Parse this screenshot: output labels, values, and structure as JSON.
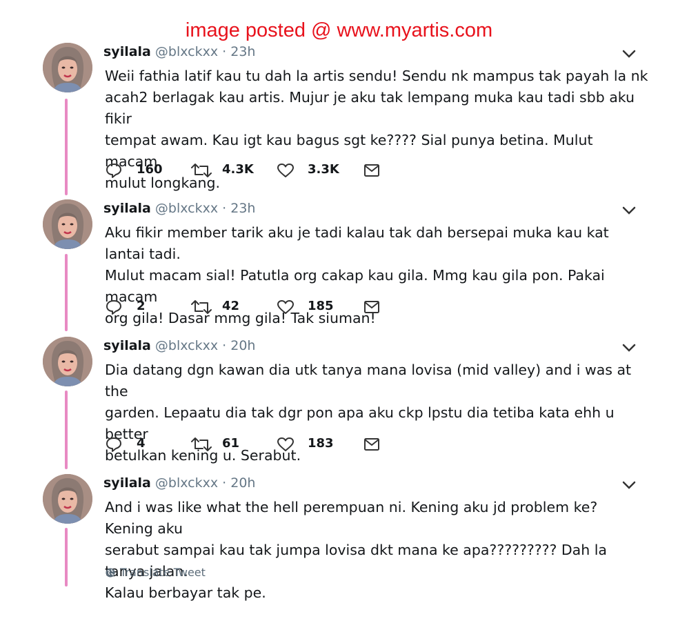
{
  "watermark": "image posted @ www.myartis.com",
  "colors": {
    "thread_line": "#e88ac3",
    "watermark": "#e8121c",
    "secondary_text": "#657786"
  },
  "tweets": [
    {
      "name": "syilala",
      "handle": "@blxckxx",
      "dot": "·",
      "time": "23h",
      "lines": [
        "Weii fathia latif kau tu dah la artis sendu! Sendu nk mampus tak payah la nk",
        "acah2 berlagak kau artis. Mujur je aku tak lempang muka kau tadi sbb aku fikir",
        "tempat awam. Kau igt kau bagus sgt ke???? Sial punya betina. Mulut macam",
        "mulut longkang."
      ],
      "replies": "160",
      "retweets": "4.3K",
      "likes": "3.3K"
    },
    {
      "name": "syilala",
      "handle": "@blxckxx",
      "dot": "·",
      "time": "23h",
      "lines": [
        "Aku fikir member tarik aku je tadi kalau tak dah bersepai muka kau kat lantai tadi.",
        "Mulut macam sial! Patutla org cakap kau gila. Mmg kau gila pon. Pakai macam",
        "org gila! Dasar mmg gila! Tak siuman!"
      ],
      "replies": "2",
      "retweets": "42",
      "likes": "185"
    },
    {
      "name": "syilala",
      "handle": "@blxckxx",
      "dot": "·",
      "time": "20h",
      "lines": [
        "Dia datang dgn kawan dia utk tanya mana lovisa (mid valley) and i was at the",
        "garden. Lepaatu dia tak dgr pon apa aku ckp lpstu dia tetiba kata ehh u better",
        "betulkan kening u. Serabut."
      ],
      "replies": "4",
      "retweets": "61",
      "likes": "183"
    },
    {
      "name": "syilala",
      "handle": "@blxckxx",
      "dot": "·",
      "time": "20h",
      "lines": [
        "And i was like what the hell perempuan ni. Kening aku jd problem ke? Kening aku",
        "serabut sampai kau tak jumpa lovisa dkt mana ke apa????????? Dah la tanya jalan.",
        "Kalau berbayar tak pe."
      ],
      "translate": "Translate Tweet"
    }
  ]
}
